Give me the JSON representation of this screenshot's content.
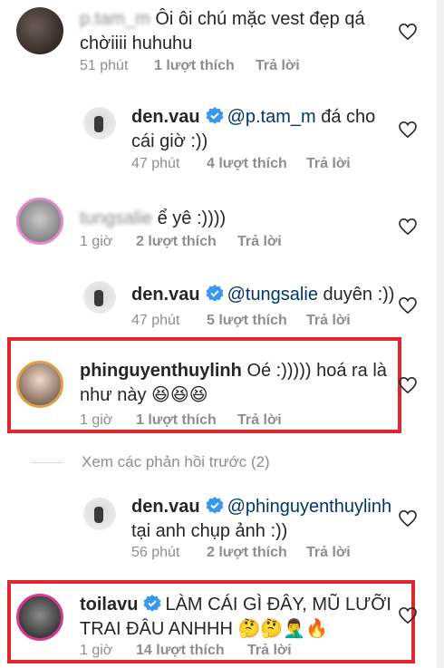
{
  "comments": [
    {
      "username": "p.tam_m",
      "text": "Ôi ôi chú mặc vest đẹp qá chờiiii huhuhu",
      "text_line1": "Ôi ôi chú mặc vest đẹp qá",
      "text_line2": "chờiiii huhuhu",
      "time": "51 phút",
      "likes": "1 lượt thích",
      "reply": "Trả lời"
    },
    {
      "username": "den.vau",
      "verified": true,
      "mention": "@p.tam_m",
      "text_after_mention": "đá cho",
      "text_line2": "cái giờ :))",
      "time": "47 phút",
      "likes": "4 lượt thích",
      "reply": "Trả lời"
    },
    {
      "username": "tungsalie",
      "text": "ể yê :))))",
      "time": "1 giờ",
      "likes": "2 lượt thích",
      "reply": "Trả lời"
    },
    {
      "username": "den.vau",
      "verified": true,
      "mention": "@tungsalie",
      "text_after_mention": "duyên :))",
      "time": "47 phút",
      "likes": "5 lượt thích",
      "reply": "Trả lời"
    },
    {
      "username": "phinguyenthuylinh",
      "text_after_user": "Oé :))))) hoá ra là",
      "text_line2": "như này 😆😆😆",
      "time": "1 giờ",
      "likes": "1 lượt thích",
      "reply": "Trả lời"
    },
    {
      "username": "den.vau",
      "verified": true,
      "mention": "@phinguyenthuylinh",
      "text_line2": "tại anh chụp ảnh :))",
      "time": "56 phút",
      "likes": "2 lượt thích",
      "reply": "Trả lời"
    },
    {
      "username": "toilavu",
      "verified": true,
      "text_after_user": "LÀM CÁI GÌ ĐÂY, MŨ LƯỠI",
      "text_line2": "TRAI ĐÂU ANHHH 🤔🤔🤦‍♂️🔥",
      "time": "1 giờ",
      "likes": "14 lượt thích",
      "reply": "Trả lời"
    }
  ],
  "view_previous": "Xem các phản hồi trước (2)",
  "colors": {
    "highlight": "#e0262e",
    "verified": "#3897f0",
    "mention": "#00376b",
    "meta": "#8e8e8e"
  },
  "icons": [
    "heart-icon",
    "verified-icon"
  ]
}
